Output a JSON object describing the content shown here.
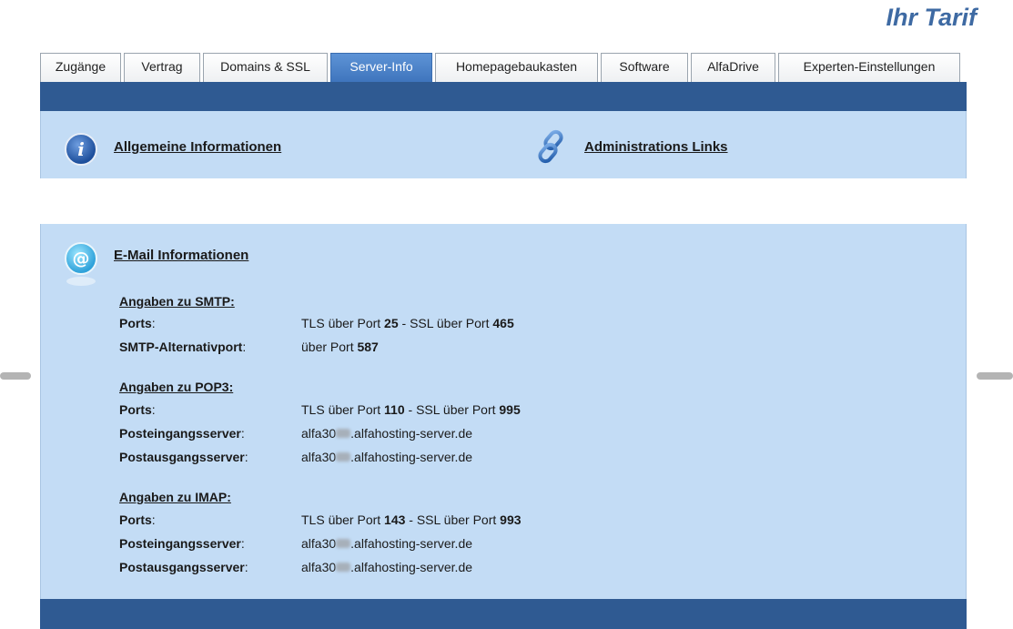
{
  "brand": {
    "title": "Ihr Tarif"
  },
  "tabs": [
    {
      "label": "Zugänge"
    },
    {
      "label": "Vertrag"
    },
    {
      "label": "Domains & SSL"
    },
    {
      "label": "Server-Info"
    },
    {
      "label": "Homepagebaukasten"
    },
    {
      "label": "Software"
    },
    {
      "label": "AlfaDrive"
    },
    {
      "label": "Experten-Einstellungen"
    }
  ],
  "active_tab": "Server-Info",
  "sections": {
    "general_info": "Allgemeine Informationen",
    "admin_links": "Administrations Links",
    "email_info": "E-Mail Informationen"
  },
  "icons": {
    "info": "info-icon",
    "link": "link-chain-icon",
    "email": "at-sign-icon"
  },
  "smtp": {
    "title": "Angaben zu SMTP:",
    "ports_label": "Ports",
    "ports_value": {
      "p1": "TLS über Port ",
      "n1": "25",
      "p2": " - SSL über Port ",
      "n2": "465"
    },
    "alt_label": "SMTP-Alternativport",
    "alt_value": {
      "p1": "über Port ",
      "n1": "587"
    }
  },
  "pop3": {
    "title": "Angaben zu POP3:",
    "ports_label": "Ports",
    "ports_value": {
      "p1": "TLS über Port ",
      "n1": "110",
      "p2": " - SSL über Port ",
      "n2": "995"
    },
    "in_label": "Posteingangsserver",
    "in_value": {
      "prefix": "alfa30",
      "suffix": ".alfahosting-server.de"
    },
    "out_label": "Postausgangsserver",
    "out_value": {
      "prefix": "alfa30",
      "suffix": ".alfahosting-server.de"
    }
  },
  "imap": {
    "title": "Angaben zu IMAP:",
    "ports_label": "Ports",
    "ports_value": {
      "p1": "TLS über Port ",
      "n1": "143",
      "p2": " - SSL über Port ",
      "n2": "993"
    },
    "in_label": "Posteingangsserver",
    "in_value": {
      "prefix": "alfa30",
      "suffix": ".alfahosting-server.de"
    },
    "out_label": "Postausgangsserver",
    "out_value": {
      "prefix": "alfa30",
      "suffix": ".alfahosting-server.de"
    }
  },
  "colors": {
    "brand": "#3e6aa3",
    "bar": "#2f5a92",
    "panel": "#c3dcf5",
    "active_tab": "#4a80c6"
  },
  "colon": ":"
}
